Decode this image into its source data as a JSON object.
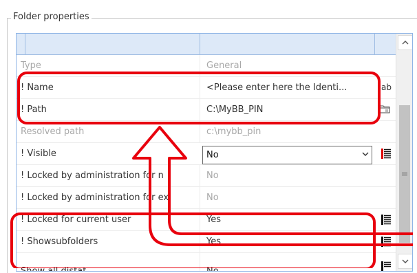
{
  "group": {
    "title": "Folder properties"
  },
  "rows": [
    {
      "mark": "",
      "label": "Type",
      "value": "General"
    },
    {
      "mark": "!",
      "label": "Name",
      "value": "<Please enter here the Identi...",
      "icon": "ab"
    },
    {
      "mark": "!",
      "label": "Path",
      "value": "C:\\MyBB_PIN",
      "icon": "folder-icon"
    },
    {
      "mark": "",
      "label": "Resolved path",
      "value": "c:\\mybb_pin"
    },
    {
      "mark": "!",
      "label": "Visible",
      "value": "No",
      "icon": "list-icon"
    },
    {
      "mark": "!",
      "label": "Locked by administration for n",
      "value": "No"
    },
    {
      "mark": "!",
      "label": "Locked by administration for ex",
      "value": "No"
    },
    {
      "mark": "!",
      "label": "Locked for current user",
      "value": "Yes",
      "icon": "list-icon"
    },
    {
      "mark": "!",
      "label": "Showsubfolders",
      "value": "Yes",
      "icon": "list-icon"
    },
    {
      "mark": "",
      "label": "Show all distat",
      "value": "No",
      "icon": "list-icon"
    }
  ],
  "annotation": {
    "color": "#e8000d"
  },
  "colors": {
    "header": "#dde9f8",
    "grid_border": "#8fb5e6",
    "dim_text": "#a8a8a8"
  }
}
